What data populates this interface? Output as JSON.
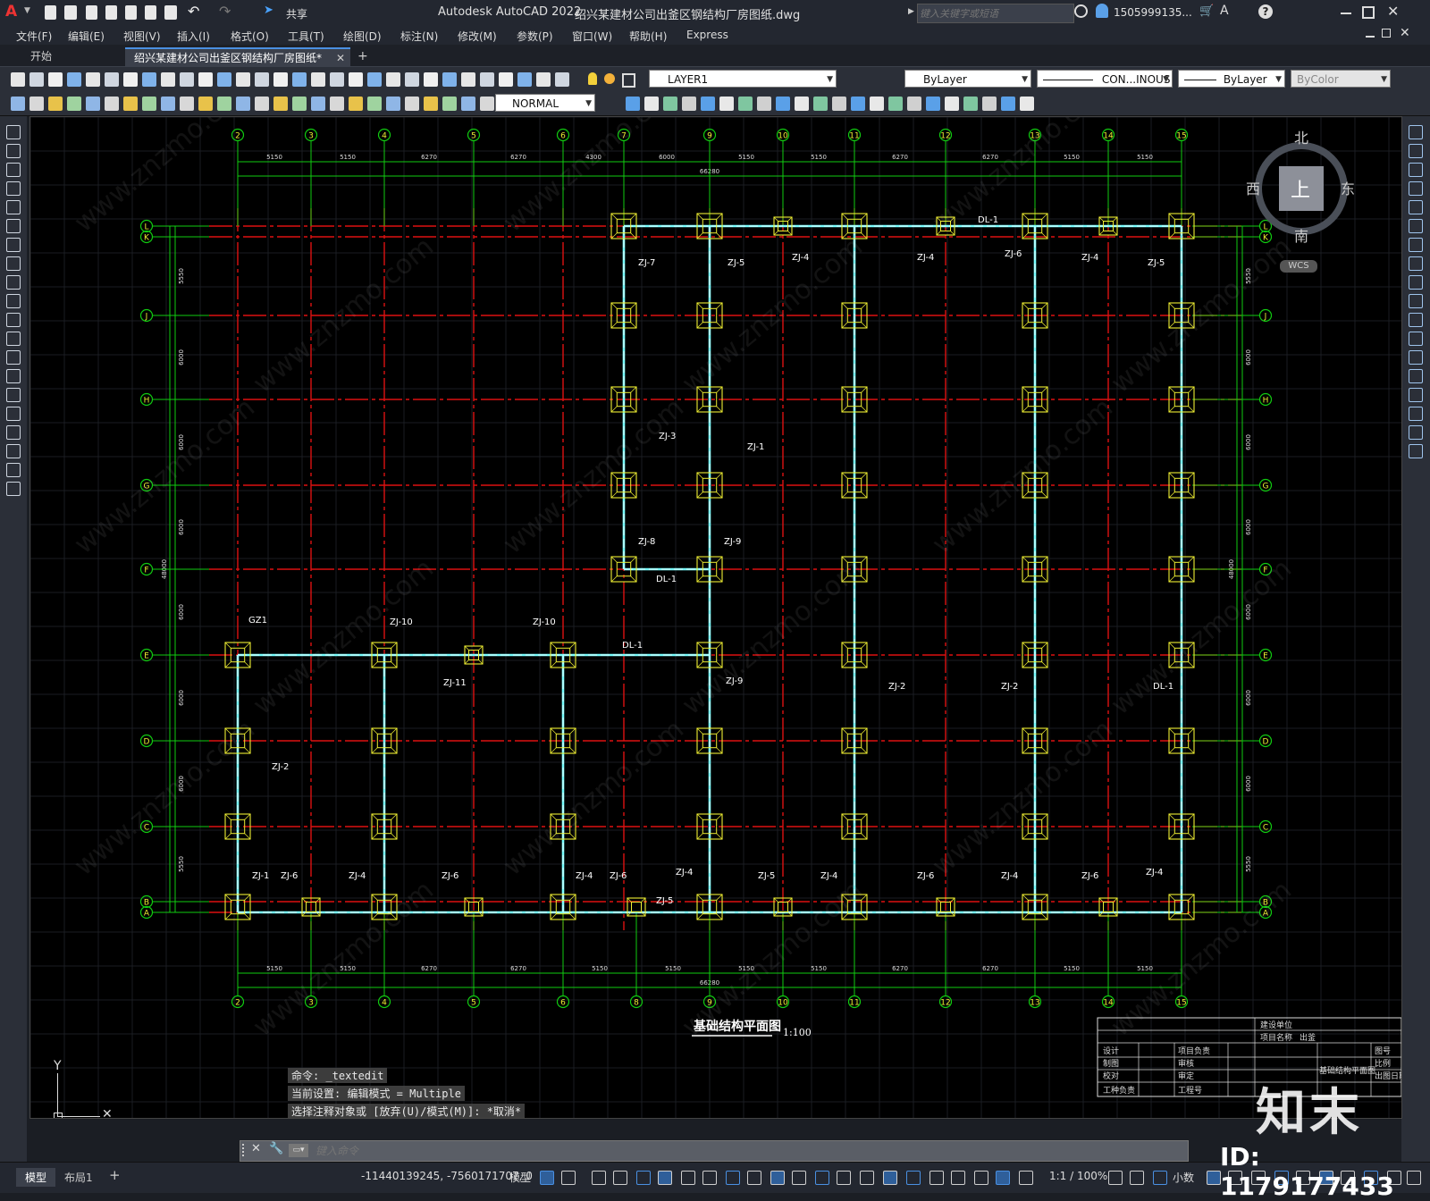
{
  "app": {
    "title": "Autodesk AutoCAD 2022",
    "filename": "绍兴某建材公司出釜区钢结构厂房图纸.dwg",
    "share_label": "共享",
    "search_placeholder": "键入关键字或短语",
    "user": "1505999135..."
  },
  "menu": [
    "文件(F)",
    "编辑(E)",
    "视图(V)",
    "插入(I)",
    "格式(O)",
    "工具(T)",
    "绘图(D)",
    "标注(N)",
    "修改(M)",
    "参数(P)",
    "窗口(W)",
    "帮助(H)",
    "Express"
  ],
  "tabs": {
    "start": "开始",
    "doc": "绍兴某建材公司出釜区钢结构厂房图纸*",
    "close": "✕",
    "add": "+"
  },
  "toolbar": {
    "layer": "LAYER1",
    "color": "ByLayer",
    "linetype": "CON...INOUS",
    "lineweight": "ByLayer",
    "plotstyle": "ByColor",
    "textstyle": "NORMAL"
  },
  "viewcube": {
    "north": "北",
    "south": "南",
    "east": "东",
    "west": "西",
    "top": "上",
    "wcs": "WCS"
  },
  "drawing": {
    "col_labels_top": [
      "2",
      "3",
      "4",
      "5",
      "6",
      "7",
      "9",
      "10",
      "11",
      "12",
      "13",
      "14",
      "15"
    ],
    "col_labels_bottom": [
      "2",
      "3",
      "4",
      "5",
      "6",
      "8",
      "9",
      "10",
      "11",
      "12",
      "13",
      "14",
      "15"
    ],
    "row_labels": [
      "L",
      "K",
      "J",
      "H",
      "G",
      "F",
      "E",
      "D",
      "C",
      "B",
      "A"
    ],
    "dims_top": [
      "5150",
      "5150",
      "6270",
      "6270",
      "4300",
      "6000",
      "5150",
      "5150",
      "6270",
      "6270",
      "5150",
      "5150"
    ],
    "dims_bottom": [
      "5150",
      "5150",
      "6270",
      "6270",
      "5150",
      "5150",
      "5150",
      "5150",
      "6270",
      "6270",
      "5150",
      "5150"
    ],
    "total_width": "66280",
    "dims_left": [
      "5550",
      "6000",
      "6000",
      "6000",
      "6000",
      "6000",
      "6000",
      "5550"
    ],
    "total_height": "48000",
    "tags": [
      "ZJ-7",
      "ZJ-5",
      "ZJ-4",
      "ZJ-4",
      "ZJ-6",
      "ZJ-4",
      "ZJ-5",
      "DL-1",
      "ZJ-3",
      "ZJ-1",
      "ZJ-8",
      "ZJ-9",
      "DL-1",
      "GZ1",
      "ZJ-10",
      "ZJ-10",
      "ZJ-11",
      "DL-1",
      "ZJ-9",
      "ZJ-2",
      "ZJ-2",
      "ZJ-2",
      "ZJ-1",
      "ZJ-6",
      "ZJ-4",
      "ZJ-6",
      "ZJ-4",
      "ZJ-6",
      "ZJ-4",
      "ZJ-5",
      "ZJ-4",
      "ZJ-6",
      "ZJ-4",
      "ZJ-6",
      "ZJ-4",
      "ZJ-5",
      "DL-1"
    ],
    "plan_title": "基础结构平面图",
    "plan_scale": "1:100",
    "titleblock": [
      "建设单位",
      "项目名称",
      "设计",
      "制图",
      "校对",
      "工种负责",
      "项目负责",
      "审核",
      "审定",
      "工程号",
      "图号",
      "比例",
      "出图日期",
      "出釜",
      "基础结构平面图"
    ]
  },
  "command": {
    "lines": [
      "命令: _textedit",
      "当前设置: 编辑模式 = Multiple",
      "选择注释对象或 [放弃(U)/模式(M)]: *取消*"
    ],
    "placeholder": "键入命令"
  },
  "status": {
    "model_tab": "模型",
    "layout_tab": "布局1",
    "add": "+",
    "coords": "-11440139245, -7560171707, 0",
    "model": "模型",
    "scale": "1:1 / 100%",
    "units": "小数"
  },
  "watermark": {
    "brand": "知末",
    "id": "ID: 1179177433",
    "site": "www.znzmo.com"
  }
}
